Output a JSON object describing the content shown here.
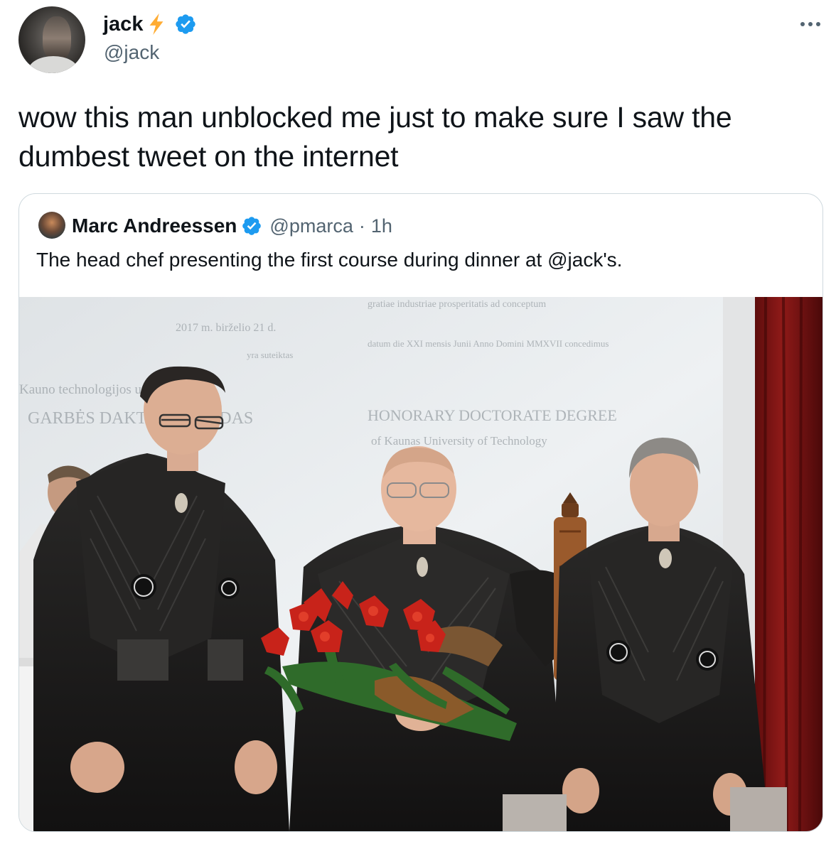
{
  "author": {
    "display_name": "jack",
    "handle": "@jack",
    "name_emoji": "lightning-icon",
    "verified": true
  },
  "menu": {
    "icon": "more-icon",
    "label": "···"
  },
  "tweet": {
    "text": "wow this man unblocked me just to make sure I saw the dumbest tweet on the internet"
  },
  "quoted_tweet": {
    "display_name": "Marc Andreessen",
    "handle": "@pmarca",
    "separator": "·",
    "time": "1h",
    "text": "The head chef presenting the first course during dinner at @jack's.",
    "verified": true
  },
  "photo": {
    "screen_text": {
      "date_line": "2017 m. birželio 21 d.",
      "sub_line": "yra suteiktas",
      "kaunas_line": "Kauno technologijos universiteto",
      "garbes_line": "GARBĖS DAKTARO VARDAS",
      "latin_line": "datum die XXI mensis Junii Anno Domini MMXVII concedimus",
      "honorary_line": "HONORARY DOCTORATE DEGREE",
      "university_line": "of Kaunas University of Technology",
      "top_line": "gratiae industriae prosperitatis ad conceptum"
    },
    "colors": {
      "screen": "#e9ecee",
      "curtain": "#7a1414",
      "robe": "#1b1a19",
      "flowers": "#c8231a",
      "scroll": "#9a5a2c"
    }
  },
  "colors": {
    "text_primary": "#0f1419",
    "text_secondary": "#536471",
    "verified_blue": "#1d9bf0",
    "bolt_yellow": "#ffac33",
    "border": "#cfd9de"
  }
}
